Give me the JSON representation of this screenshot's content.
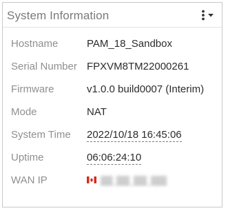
{
  "widget": {
    "title": "System Information",
    "menu_icon": "kebab-menu-caret-icon"
  },
  "rows": [
    {
      "label": "Hostname",
      "value": "PAM_18_Sandbox"
    },
    {
      "label": "Serial Number",
      "value": "FPXVM8TM22000261"
    },
    {
      "label": "Firmware",
      "value": "v1.0.0 build0007 (Interim)"
    },
    {
      "label": "Mode",
      "value": "NAT"
    },
    {
      "label": "System Time",
      "value": "2022/10/18 16:45:06"
    },
    {
      "label": "Uptime",
      "value": "06:06:24:10"
    },
    {
      "label": "WAN IP",
      "value": "",
      "flag_icon": "canada-flag-icon"
    }
  ],
  "colors": {
    "label": "#8f8f8f",
    "value": "#2b2b2b",
    "border": "#c8c8c8",
    "flag_red": "#d52b1e"
  }
}
